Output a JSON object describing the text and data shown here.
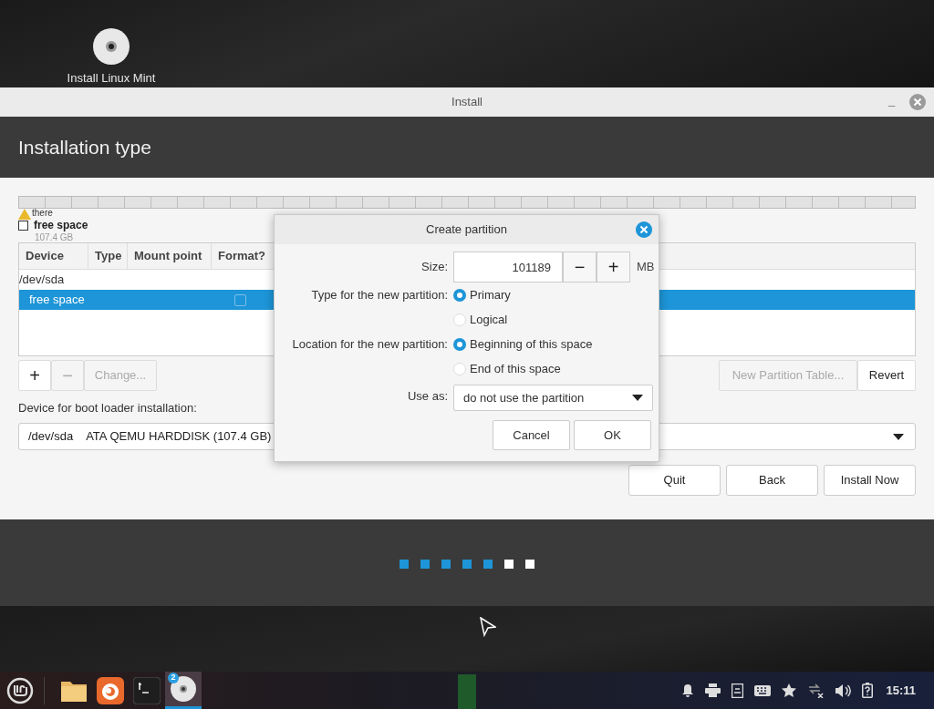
{
  "desktop": {
    "icon_label": "Install Linux Mint"
  },
  "window": {
    "title": "Install",
    "minimize": "_",
    "heading": "Installation type"
  },
  "legend": {
    "warning_text": "there",
    "label": "free space",
    "size": "107.4 GB"
  },
  "partition_table": {
    "columns": [
      "Device",
      "Type",
      "Mount point",
      "Format?"
    ],
    "rows": [
      {
        "kind": "disk",
        "device": "/dev/sda",
        "selected": false
      },
      {
        "kind": "partition",
        "device": "free space",
        "selected": true,
        "format_checked": false
      }
    ]
  },
  "table_buttons": [
    {
      "label": "+",
      "disabled": false
    },
    {
      "label": "−",
      "disabled": true
    },
    {
      "label": "Change...",
      "disabled": true
    }
  ],
  "right_buttons": [
    {
      "label": "New Partition Table...",
      "disabled": true
    },
    {
      "label": "Revert",
      "disabled": false
    }
  ],
  "boot_loader": {
    "label": "Device for boot loader installation:",
    "device": "/dev/sda",
    "description": "ATA QEMU HARDDISK (107.4 GB)"
  },
  "nav_buttons": [
    "Quit",
    "Back",
    "Install Now"
  ],
  "progress": {
    "steps": [
      {
        "done": true
      },
      {
        "done": true
      },
      {
        "done": true
      },
      {
        "done": true
      },
      {
        "done": true
      },
      {
        "done": false
      },
      {
        "done": false
      }
    ]
  },
  "dialog": {
    "title": "Create partition",
    "size_label": "Size:",
    "size_value": "101189",
    "decrement": "−",
    "increment": "+",
    "unit": "MB",
    "type_label": "Type for the new partition:",
    "type_options": [
      {
        "label": "Primary",
        "selected": true
      },
      {
        "label": "Logical",
        "selected": false
      }
    ],
    "location_label": "Location for the new partition:",
    "location_options": [
      {
        "label": "Beginning of this space",
        "selected": true
      },
      {
        "label": "End of this space",
        "selected": false
      }
    ],
    "use_as_label": "Use as:",
    "use_as_value": "do not use the partition",
    "buttons": [
      "Cancel",
      "OK"
    ]
  },
  "taskbar": {
    "apps": [
      {
        "kind": "files",
        "active": false
      },
      {
        "kind": "firefox",
        "active": false
      },
      {
        "kind": "terminal",
        "active": false
      },
      {
        "kind": "disc",
        "active": true,
        "badge": "2"
      }
    ],
    "clock": "15:11"
  }
}
